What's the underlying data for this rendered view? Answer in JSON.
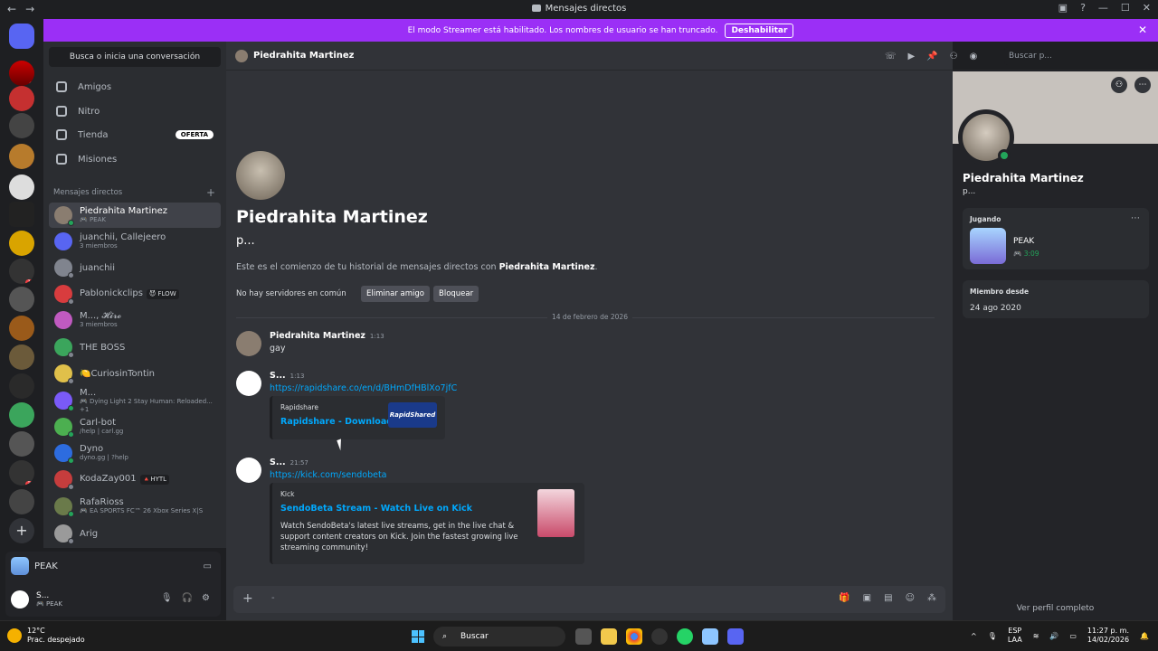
{
  "window": {
    "title": "Mensajes directos",
    "back_label": "←",
    "forward_label": "→",
    "minimize_label": "—",
    "maximize_label": "☐",
    "close_label": "✕"
  },
  "banner": {
    "text": "El modo Streamer está habilitado. Los nombres de usuario se han truncado.",
    "disable_label": "Deshabilitar",
    "close_label": "✕"
  },
  "servers": {
    "badges": [
      "2",
      "6",
      "10",
      "35"
    ]
  },
  "dm_sidebar": {
    "search_label": "Busca o inicia una conversación",
    "nav": [
      {
        "label": "Amigos",
        "icon": "friends-icon"
      },
      {
        "label": "Nitro",
        "icon": "nitro-icon"
      },
      {
        "label": "Tienda",
        "icon": "shop-icon",
        "badge": "OFERTA"
      },
      {
        "label": "Misiones",
        "icon": "quests-icon"
      }
    ],
    "section_title": "Mensajes directos",
    "add_label": "+",
    "conversations": [
      {
        "name": "Piedrahita Martinez",
        "sub": "🎮 PEAK",
        "active": true,
        "color": "#8a7d70"
      },
      {
        "name": "juanchii, Callejeero",
        "sub": "3 miembros",
        "color": "#5865f2"
      },
      {
        "name": "juanchii",
        "sub": "",
        "color": "#80848e"
      },
      {
        "name": "Pablonickclips",
        "tag": "😈 FLOW",
        "sub": "",
        "color": "#d83c3e"
      },
      {
        "name": "M..., 𝓗𝓲𝓻𝓸",
        "sub": "3 miembros",
        "color": "#c05ac0"
      },
      {
        "name": "THE BOSS",
        "sub": "",
        "color": "#3ba55c"
      },
      {
        "name": "🍋CuriosinTontin",
        "sub": "",
        "color": "#e0c04a"
      },
      {
        "name": "M...",
        "sub": "🎮 Dying Light 2 Stay Human: Reloaded... +1",
        "color": "#7a5af8"
      },
      {
        "name": "Carl-bot",
        "sub": "/help | carl.gg",
        "color": "#4caf50"
      },
      {
        "name": "Dyno",
        "sub": "dyno.gg | ?help",
        "color": "#2d6cdf"
      },
      {
        "name": "KodaZay001",
        "tag": "🔺HYTL",
        "sub": "",
        "color": "#c63d3d"
      },
      {
        "name": "RafaRioss",
        "sub": "🎮 EA SPORTS FC™ 26 Xbox Series X|S",
        "color": "#6a7a4a"
      },
      {
        "name": "Arig",
        "sub": "",
        "color": "#9a9a9a"
      }
    ]
  },
  "panel": {
    "game_name": "PEAK",
    "user_name": "S...",
    "user_status": "🎮 PEAK"
  },
  "chat": {
    "header_name": "Piedrahita Martinez",
    "search_placeholder": "Buscar p...",
    "intro": {
      "name": "Piedrahita Martinez",
      "handle": "p...",
      "desc_prefix": "Este es el comienzo de tu historial de mensajes directos con ",
      "desc_name": "Piedrahita Martinez",
      "desc_suffix": ".",
      "mutual": "No hay servidores en común",
      "remove_friend": "Eliminar amigo",
      "block": "Bloquear"
    },
    "date_divider": "14 de febrero de 2026",
    "messages": [
      {
        "author": "Piedrahita Martinez",
        "time": "1:13",
        "text": "gay"
      },
      {
        "author": "S...",
        "time": "1:13",
        "link": "https://rapidshare.co/en/d/BHmDfHBlXo7jfC",
        "embed": {
          "provider": "Rapidshare",
          "title": "Rapidshare - Download",
          "thumb_text": "RapidShared"
        }
      },
      {
        "author": "S...",
        "time": "21:57",
        "link": "https://kick.com/sendobeta",
        "embed": {
          "provider": "Kick",
          "title": "SendoBeta Stream - Watch Live on Kick",
          "description": "Watch SendoBeta's latest live streams, get in the live chat & support content creators on Kick. Join the fastest growing live streaming community!"
        }
      }
    ],
    "composer_placeholder": "-"
  },
  "profile": {
    "name": "Piedrahita Martinez",
    "handle": "p...",
    "playing_title": "Jugando",
    "game": "PEAK",
    "game_time": "🎮 3:09",
    "member_since_title": "Miembro desde",
    "member_since": "24 ago 2020",
    "view_full": "Ver perfil completo"
  },
  "taskbar": {
    "temp": "12°C",
    "weather": "Prac. despejado",
    "search": "Buscar",
    "lang1": "ESP",
    "lang2": "LAA",
    "time": "11:27 p. m.",
    "date": "14/02/2026"
  }
}
